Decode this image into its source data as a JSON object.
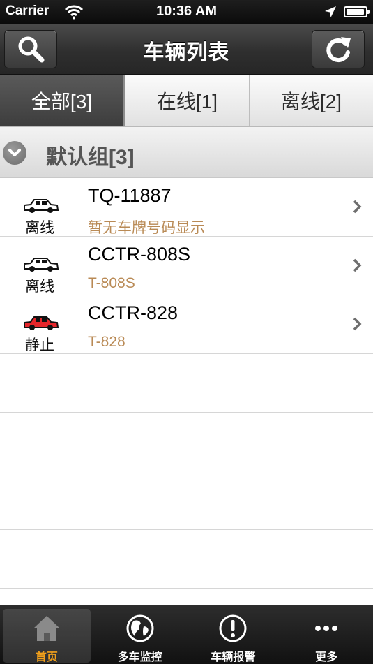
{
  "status_bar": {
    "carrier": "Carrier",
    "time": "10:36 AM",
    "battery_level": 0.95
  },
  "nav": {
    "title": "车辆列表",
    "left_icon": "search-icon",
    "right_icon": "refresh-icon"
  },
  "tabs": [
    {
      "label": "全部[3]",
      "active": true
    },
    {
      "label": "在线[1]",
      "active": false
    },
    {
      "label": "离线[2]",
      "active": false
    }
  ],
  "group": {
    "title": "默认组[3]"
  },
  "vehicles": [
    {
      "name": "TQ-11887",
      "status": "离线",
      "plate": "暂无车牌号码显示",
      "car_color": "#ffffff"
    },
    {
      "name": "CCTR-808S",
      "status": "离线",
      "plate": "T-808S",
      "car_color": "#ffffff"
    },
    {
      "name": "CCTR-828",
      "status": "静止",
      "plate": "T-828",
      "car_color": "#e5262b"
    }
  ],
  "tabbar": [
    {
      "label": "首页",
      "icon": "home-icon",
      "active": true
    },
    {
      "label": "多车监控",
      "icon": "globe-icon",
      "active": false
    },
    {
      "label": "车辆报警",
      "icon": "alert-icon",
      "active": false
    },
    {
      "label": "更多",
      "icon": "more-icon",
      "active": false
    }
  ]
}
